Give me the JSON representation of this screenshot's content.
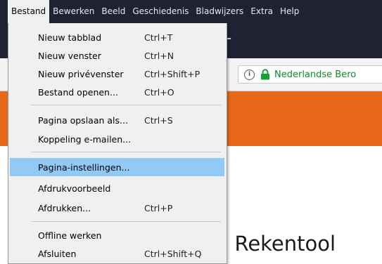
{
  "menubar": {
    "items": [
      {
        "label": "Bestand"
      },
      {
        "label": "Bewerken"
      },
      {
        "label": "Beeld"
      },
      {
        "label": "Geschiedenis"
      },
      {
        "label": "Bladwijzers"
      },
      {
        "label": "Extra"
      },
      {
        "label": "Help"
      }
    ]
  },
  "tabstrip": {
    "new_tab_symbol": "+"
  },
  "urlbar": {
    "info_symbol": "i",
    "url_text": "Nederlandse Bero",
    "icon": "lock-icon",
    "secure_color": "#12a333"
  },
  "page": {
    "banner_color": "#e8691a",
    "heading": "C  Rekentool"
  },
  "file_menu": {
    "items": [
      {
        "label": "Nieuw tabblad",
        "shortcut": "Ctrl+T"
      },
      {
        "label": "Nieuw venster",
        "shortcut": "Ctrl+N"
      },
      {
        "label": "Nieuw privévenster",
        "shortcut": "Ctrl+Shift+P"
      },
      {
        "label": "Bestand openen...",
        "shortcut": "Ctrl+O"
      },
      {
        "label": "Pagina opslaan als...",
        "shortcut": "Ctrl+S"
      },
      {
        "label": "Koppeling e-mailen...",
        "shortcut": ""
      },
      {
        "label": "Pagina-instellingen...",
        "shortcut": "",
        "highlighted": true
      },
      {
        "label": "Afdrukvoorbeeld",
        "shortcut": ""
      },
      {
        "label": "Afdrukken...",
        "shortcut": "Ctrl+P"
      },
      {
        "label": "Offline werken",
        "shortcut": ""
      },
      {
        "label": "Afsluiten",
        "shortcut": "Ctrl+Shift+Q"
      }
    ]
  },
  "colors": {
    "menubar_bg": "#1f2232",
    "highlight": "#91c9f7",
    "menu_bg": "#f0f0f0"
  }
}
